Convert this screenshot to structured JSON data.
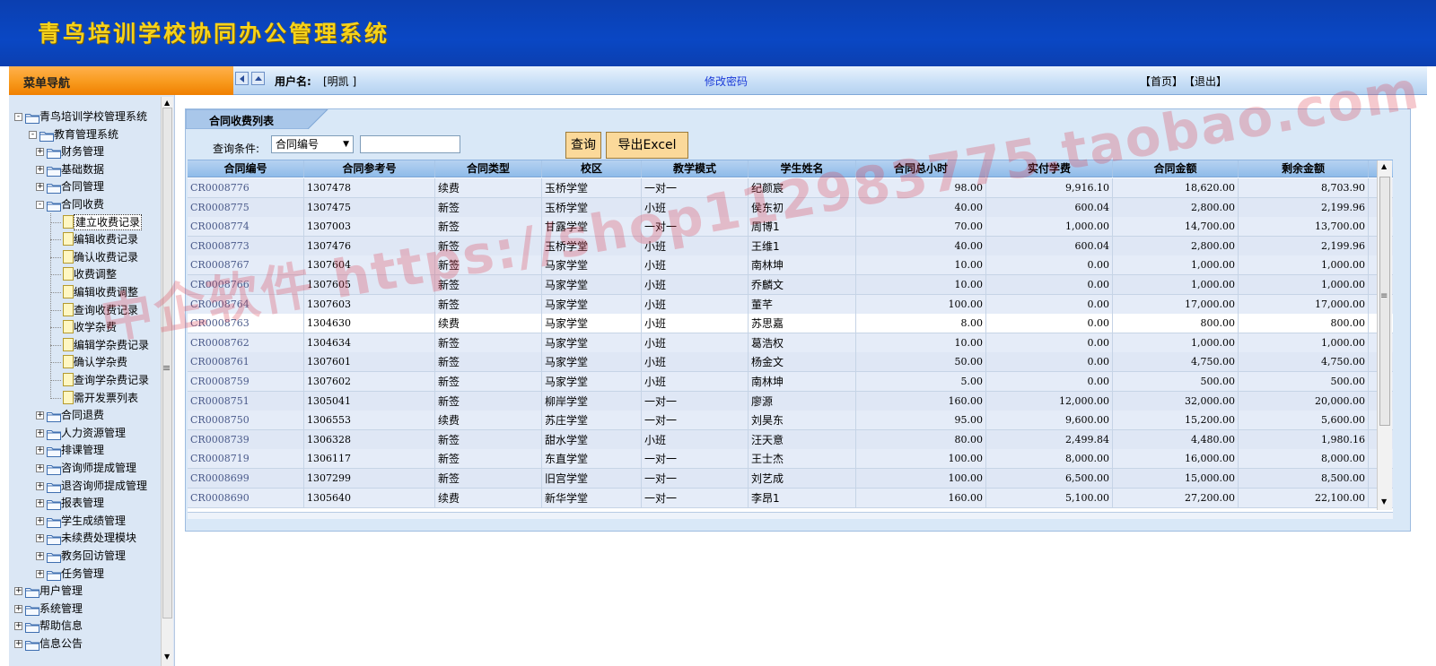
{
  "header": {
    "title": "青鸟培训学校协同办公管理系统"
  },
  "menu": {
    "label": "菜单导航"
  },
  "topbar": {
    "user_label": "用户名:",
    "user_value": "[明凯 ]",
    "change_password": "修改密码",
    "home": "【首页】",
    "logout": "【退出】"
  },
  "tree": {
    "root": "青鸟培训学校管理系统",
    "edu": "教育管理系统",
    "finance": "财务管理",
    "basic": "基础数据",
    "contract_mgmt": "合同管理",
    "contract_fee": "合同收费",
    "fee_children": [
      "建立收费记录",
      "编辑收费记录",
      "确认收费记录",
      "收费调整",
      "编辑收费调整",
      "查询收费记录",
      "收学杂费",
      "编辑学杂费记录",
      "确认学杂费",
      "查询学杂费记录",
      "需开发票列表"
    ],
    "after_fee": [
      "合同退费",
      "人力资源管理",
      "排课管理",
      "咨询师提成管理",
      "退咨询师提成管理",
      "报表管理",
      "学生成绩管理",
      "未续费处理模块",
      "教务回访管理",
      "任务管理"
    ],
    "top_level": [
      "用户管理",
      "系统管理",
      "帮助信息",
      "信息公告"
    ]
  },
  "panel": {
    "title": "合同收费列表",
    "query_label": "查询条件:",
    "query_select": "合同编号",
    "query_value": "",
    "query_button": "查询",
    "excel_button": "导出Excel"
  },
  "table": {
    "columns": [
      "合同编号",
      "合同参考号",
      "合同类型",
      "校区",
      "教学模式",
      "学生姓名",
      "合同总小时",
      "实付学费",
      "合同金额",
      "剩余金额"
    ],
    "rows": [
      [
        "CR0008776",
        "1307478",
        "续费",
        "玉桥学堂",
        "一对一",
        "纪颜宸",
        "98.00",
        "9,916.10",
        "18,620.00",
        "8,703.90"
      ],
      [
        "CR0008775",
        "1307475",
        "新签",
        "玉桥学堂",
        "小班",
        "侯东初",
        "40.00",
        "600.04",
        "2,800.00",
        "2,199.96"
      ],
      [
        "CR0008774",
        "1307003",
        "新签",
        "甘露学堂",
        "一对一",
        "周博1",
        "70.00",
        "1,000.00",
        "14,700.00",
        "13,700.00"
      ],
      [
        "CR0008773",
        "1307476",
        "新签",
        "玉桥学堂",
        "小班",
        "王维1",
        "40.00",
        "600.04",
        "2,800.00",
        "2,199.96"
      ],
      [
        "CR0008767",
        "1307604",
        "新签",
        "马家学堂",
        "小班",
        "南林坤",
        "10.00",
        "0.00",
        "1,000.00",
        "1,000.00"
      ],
      [
        "CR0008766",
        "1307605",
        "新签",
        "马家学堂",
        "小班",
        "乔麟文",
        "10.00",
        "0.00",
        "1,000.00",
        "1,000.00"
      ],
      [
        "CR0008764",
        "1307603",
        "新签",
        "马家学堂",
        "小班",
        "董芊",
        "100.00",
        "0.00",
        "17,000.00",
        "17,000.00"
      ],
      [
        "CR0008763",
        "1304630",
        "续费",
        "马家学堂",
        "小班",
        "苏思嘉",
        "8.00",
        "0.00",
        "800.00",
        "800.00"
      ],
      [
        "CR0008762",
        "1304634",
        "新签",
        "马家学堂",
        "小班",
        "葛浩权",
        "10.00",
        "0.00",
        "1,000.00",
        "1,000.00"
      ],
      [
        "CR0008761",
        "1307601",
        "新签",
        "马家学堂",
        "小班",
        "杨金文",
        "50.00",
        "0.00",
        "4,750.00",
        "4,750.00"
      ],
      [
        "CR0008759",
        "1307602",
        "新签",
        "马家学堂",
        "小班",
        "南林坤",
        "5.00",
        "0.00",
        "500.00",
        "500.00"
      ],
      [
        "CR0008751",
        "1305041",
        "新签",
        "柳岸学堂",
        "一对一",
        "廖源",
        "160.00",
        "12,000.00",
        "32,000.00",
        "20,000.00"
      ],
      [
        "CR0008750",
        "1306553",
        "续费",
        "苏庄学堂",
        "一对一",
        "刘昊东",
        "95.00",
        "9,600.00",
        "15,200.00",
        "5,600.00"
      ],
      [
        "CR0008739",
        "1306328",
        "新签",
        "甜水学堂",
        "小班",
        "汪天意",
        "80.00",
        "2,499.84",
        "4,480.00",
        "1,980.16"
      ],
      [
        "CR0008719",
        "1306117",
        "新签",
        "东直学堂",
        "一对一",
        "王士杰",
        "100.00",
        "8,000.00",
        "16,000.00",
        "8,000.00"
      ],
      [
        "CR0008699",
        "1307299",
        "新签",
        "旧宫学堂",
        "一对一",
        "刘艺成",
        "100.00",
        "6,500.00",
        "15,000.00",
        "8,500.00"
      ],
      [
        "CR0008690",
        "1305640",
        "续费",
        "新华学堂",
        "一对一",
        "李昂1",
        "160.00",
        "5,100.00",
        "27,200.00",
        "22,100.00"
      ]
    ]
  },
  "watermark": "中企软件 https://shop112983775.taobao.com"
}
